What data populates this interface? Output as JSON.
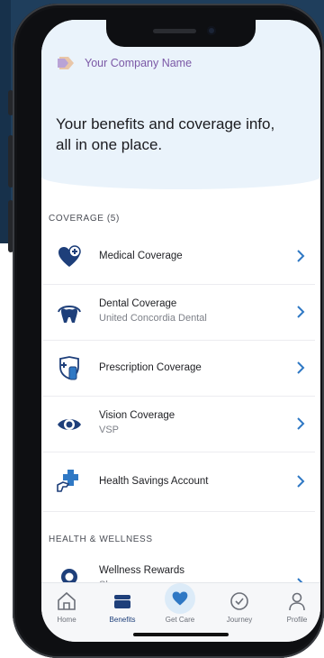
{
  "brand": {
    "name": "Your Company Name"
  },
  "hero": {
    "title": "Your benefits and coverage info, all in one place."
  },
  "coverage": {
    "section_label": "COVERAGE (5)",
    "items": [
      {
        "title": "Medical Coverage",
        "subtitle": "",
        "icon": "heart-plus-icon"
      },
      {
        "title": "Dental Coverage",
        "subtitle": "United Concordia Dental",
        "icon": "tooth-icon"
      },
      {
        "title": "Prescription Coverage",
        "subtitle": "",
        "icon": "shield-pill-icon"
      },
      {
        "title": "Vision Coverage",
        "subtitle": "VSP",
        "icon": "eye-icon"
      },
      {
        "title": "Health Savings Account",
        "subtitle": "",
        "icon": "hand-cross-icon"
      }
    ]
  },
  "wellness": {
    "section_label": "HEALTH & WELLNESS",
    "items": [
      {
        "title": "Wellness Rewards",
        "subtitle": "Sharecare",
        "icon": "award-icon"
      }
    ]
  },
  "tabbar": {
    "tabs": [
      {
        "label": "Home",
        "icon": "home-icon",
        "active": false
      },
      {
        "label": "Benefits",
        "icon": "wallet-icon",
        "active": true
      },
      {
        "label": "Get Care",
        "icon": "heart-icon",
        "active": false
      },
      {
        "label": "Journey",
        "icon": "clock-check-icon",
        "active": false
      },
      {
        "label": "Profile",
        "icon": "person-icon",
        "active": false
      }
    ]
  },
  "colors": {
    "accent": "#1e3f7a",
    "brand_purple": "#7b58a6",
    "hero_bg": "#eaf3fb",
    "chevron": "#2f78c4"
  }
}
